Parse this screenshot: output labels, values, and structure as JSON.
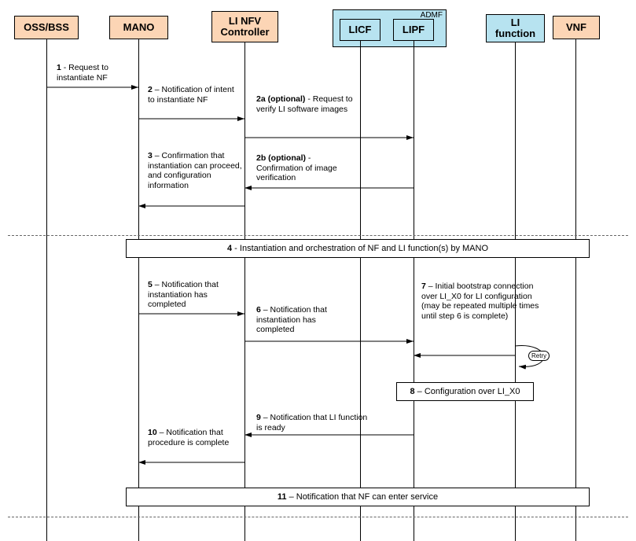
{
  "participants": {
    "ossbss": "OSS/BSS",
    "mano": "MANO",
    "linfv": "LI NFV Controller",
    "licf": "LICF",
    "lipf": "LIPF",
    "lifunc": "LI function",
    "vnf": "VNF",
    "admf": "ADMF"
  },
  "messages": {
    "m1": {
      "num": "1",
      "text": " - Request to instantiate NF"
    },
    "m2": {
      "num": "2",
      "text": " – Notification of intent to instantiate NF"
    },
    "m2a": {
      "num": "2a (optional)",
      "text": "  - Request to verify LI software images"
    },
    "m2b": {
      "num": "2b (optional)",
      "text": " - Confirmation of image verification"
    },
    "m3": {
      "num": "3",
      "text": " – Confirmation that instantiation can proceed, and configuration information"
    },
    "m4": {
      "num": "4",
      "text": " - Instantiation and orchestration of NF and LI function(s) by MANO"
    },
    "m5": {
      "num": "5",
      "text": " – Notification that instantiation has completed"
    },
    "m6": {
      "num": "6",
      "text": " – Notification that instantiation has completed"
    },
    "m7": {
      "num": "7",
      "text": " – Initial bootstrap connection over LI_X0 for LI configuration (may be repeated multiple times until step 6 is complete)"
    },
    "m8": {
      "num": "8",
      "text": " – Configuration over LI_X0"
    },
    "m9": {
      "num": "9",
      "text": " – Notification that LI function is ready"
    },
    "m10": {
      "num": "10",
      "text": " – Notification that procedure is complete"
    },
    "m11": {
      "num": "11",
      "text": " – Notification that NF can enter service"
    },
    "retry": "Retry"
  },
  "chart_data": {
    "type": "sequence-diagram",
    "participants": [
      "OSS/BSS",
      "MANO",
      "LI NFV Controller",
      "LICF",
      "LIPF",
      "LI function",
      "VNF"
    ],
    "groups": [
      {
        "name": "ADMF",
        "members": [
          "LICF",
          "LIPF"
        ]
      }
    ],
    "messages": [
      {
        "id": "1",
        "from": "OSS/BSS",
        "to": "MANO",
        "label": "Request to instantiate NF"
      },
      {
        "id": "2",
        "from": "MANO",
        "to": "LI NFV Controller",
        "label": "Notification of intent to instantiate NF"
      },
      {
        "id": "2a",
        "from": "LI NFV Controller",
        "to": "LIPF",
        "label": "Request to verify LI software images",
        "optional": true
      },
      {
        "id": "2b",
        "from": "LIPF",
        "to": "LI NFV Controller",
        "label": "Confirmation of image verification",
        "optional": true
      },
      {
        "id": "3",
        "from": "LI NFV Controller",
        "to": "MANO",
        "label": "Confirmation that instantiation can proceed, and configuration information"
      },
      {
        "id": "4",
        "span": [
          "MANO",
          "VNF"
        ],
        "label": "Instantiation and orchestration of NF and LI function(s) by MANO",
        "box": true
      },
      {
        "id": "5",
        "from": "MANO",
        "to": "LI NFV Controller",
        "label": "Notification that instantiation has completed"
      },
      {
        "id": "6",
        "from": "LI NFV Controller",
        "to": "LIPF",
        "label": "Notification that instantiation has completed"
      },
      {
        "id": "7",
        "from": "LI function",
        "to": "LIPF",
        "label": "Initial bootstrap connection over LI_X0 for LI configuration (may be repeated multiple times until step 6 is complete)",
        "loop": "Retry"
      },
      {
        "id": "8",
        "from": "LIPF",
        "to": "LI function",
        "label": "Configuration over LI_X0",
        "box": true
      },
      {
        "id": "9",
        "from": "LIPF",
        "to": "LI NFV Controller",
        "label": "Notification that LI function is ready"
      },
      {
        "id": "10",
        "from": "LI NFV Controller",
        "to": "MANO",
        "label": "Notification that procedure is complete"
      },
      {
        "id": "11",
        "span": [
          "MANO",
          "VNF"
        ],
        "label": "Notification that NF can enter service",
        "box": true
      }
    ]
  }
}
